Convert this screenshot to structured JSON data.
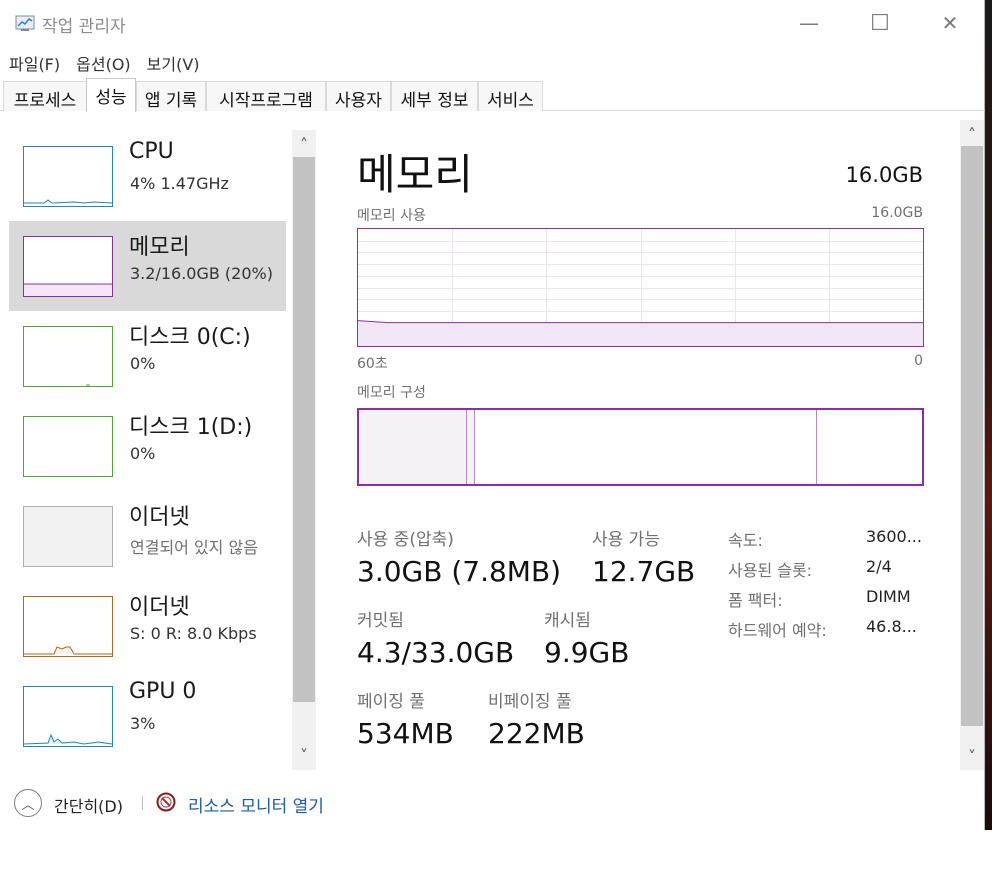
{
  "window": {
    "title": "작업 관리자",
    "controls": {
      "minimize": "—",
      "maximize": "☐",
      "close": "✕"
    }
  },
  "menu": [
    "파일(F)",
    "옵션(O)",
    "보기(V)"
  ],
  "tabs": [
    {
      "label": "프로세스",
      "active": false
    },
    {
      "label": "성능",
      "active": true
    },
    {
      "label": "앱 기록",
      "active": false
    },
    {
      "label": "시작프로그램",
      "active": false
    },
    {
      "label": "사용자",
      "active": false
    },
    {
      "label": "세부 정보",
      "active": false
    },
    {
      "label": "서비스",
      "active": false
    }
  ],
  "sidebar": {
    "items": [
      {
        "name": "CPU",
        "sub": "4% 1.47GHz",
        "color": "#1e86c8",
        "icon": "cpu-graph"
      },
      {
        "name": "메모리",
        "sub": "3.2/16.0GB (20%)",
        "color": "#8b2fa8",
        "icon": "memory-graph",
        "selected": true
      },
      {
        "name": "디스크 0(C:)",
        "sub": "0%",
        "color": "#4caa2c",
        "icon": "disk-graph"
      },
      {
        "name": "디스크 1(D:)",
        "sub": "0%",
        "color": "#4caa2c",
        "icon": "disk-graph"
      },
      {
        "name": "이더넷",
        "sub": "연결되어 있지 않음",
        "color": "#a0a0a0",
        "icon": "ethernet-graph"
      },
      {
        "name": "이더넷",
        "sub": "S: 0 R: 8.0 Kbps",
        "color": "#b5651d",
        "icon": "ethernet-graph"
      },
      {
        "name": "GPU 0",
        "sub": "3%",
        "color": "#1e86c8",
        "icon": "gpu-graph"
      }
    ]
  },
  "main": {
    "title": "메모리",
    "total": "16.0GB",
    "usage_label": "메모리 사용",
    "usage_max": "16.0GB",
    "axis_left": "60초",
    "axis_right": "0",
    "composition_label": "메모리 구성",
    "usage_level_fraction": 0.2,
    "accent_color": "#8b2fa8",
    "stats": {
      "in_use_label": "사용 중(압축)",
      "in_use_value": "3.0GB (7.8MB)",
      "available_label": "사용 가능",
      "available_value": "12.7GB",
      "committed_label": "커밋됨",
      "committed_value": "4.3/33.0GB",
      "cached_label": "캐시됨",
      "cached_value": "9.9GB",
      "paged_label": "페이징 풀",
      "paged_value": "534MB",
      "nonpaged_label": "비페이징 풀",
      "nonpaged_value": "222MB"
    },
    "properties": [
      {
        "label": "속도:",
        "value": "3600..."
      },
      {
        "label": "사용된 슬롯:",
        "value": "2/4"
      },
      {
        "label": "폼 팩터:",
        "value": "DIMM"
      },
      {
        "label": "하드웨어 예약:",
        "value": "46.8..."
      }
    ]
  },
  "footer": {
    "collapse_label": "간단히(D)",
    "monitor_link": "리소스 모니터 열기"
  },
  "scroll": {
    "up": "˄",
    "down": "˅"
  }
}
